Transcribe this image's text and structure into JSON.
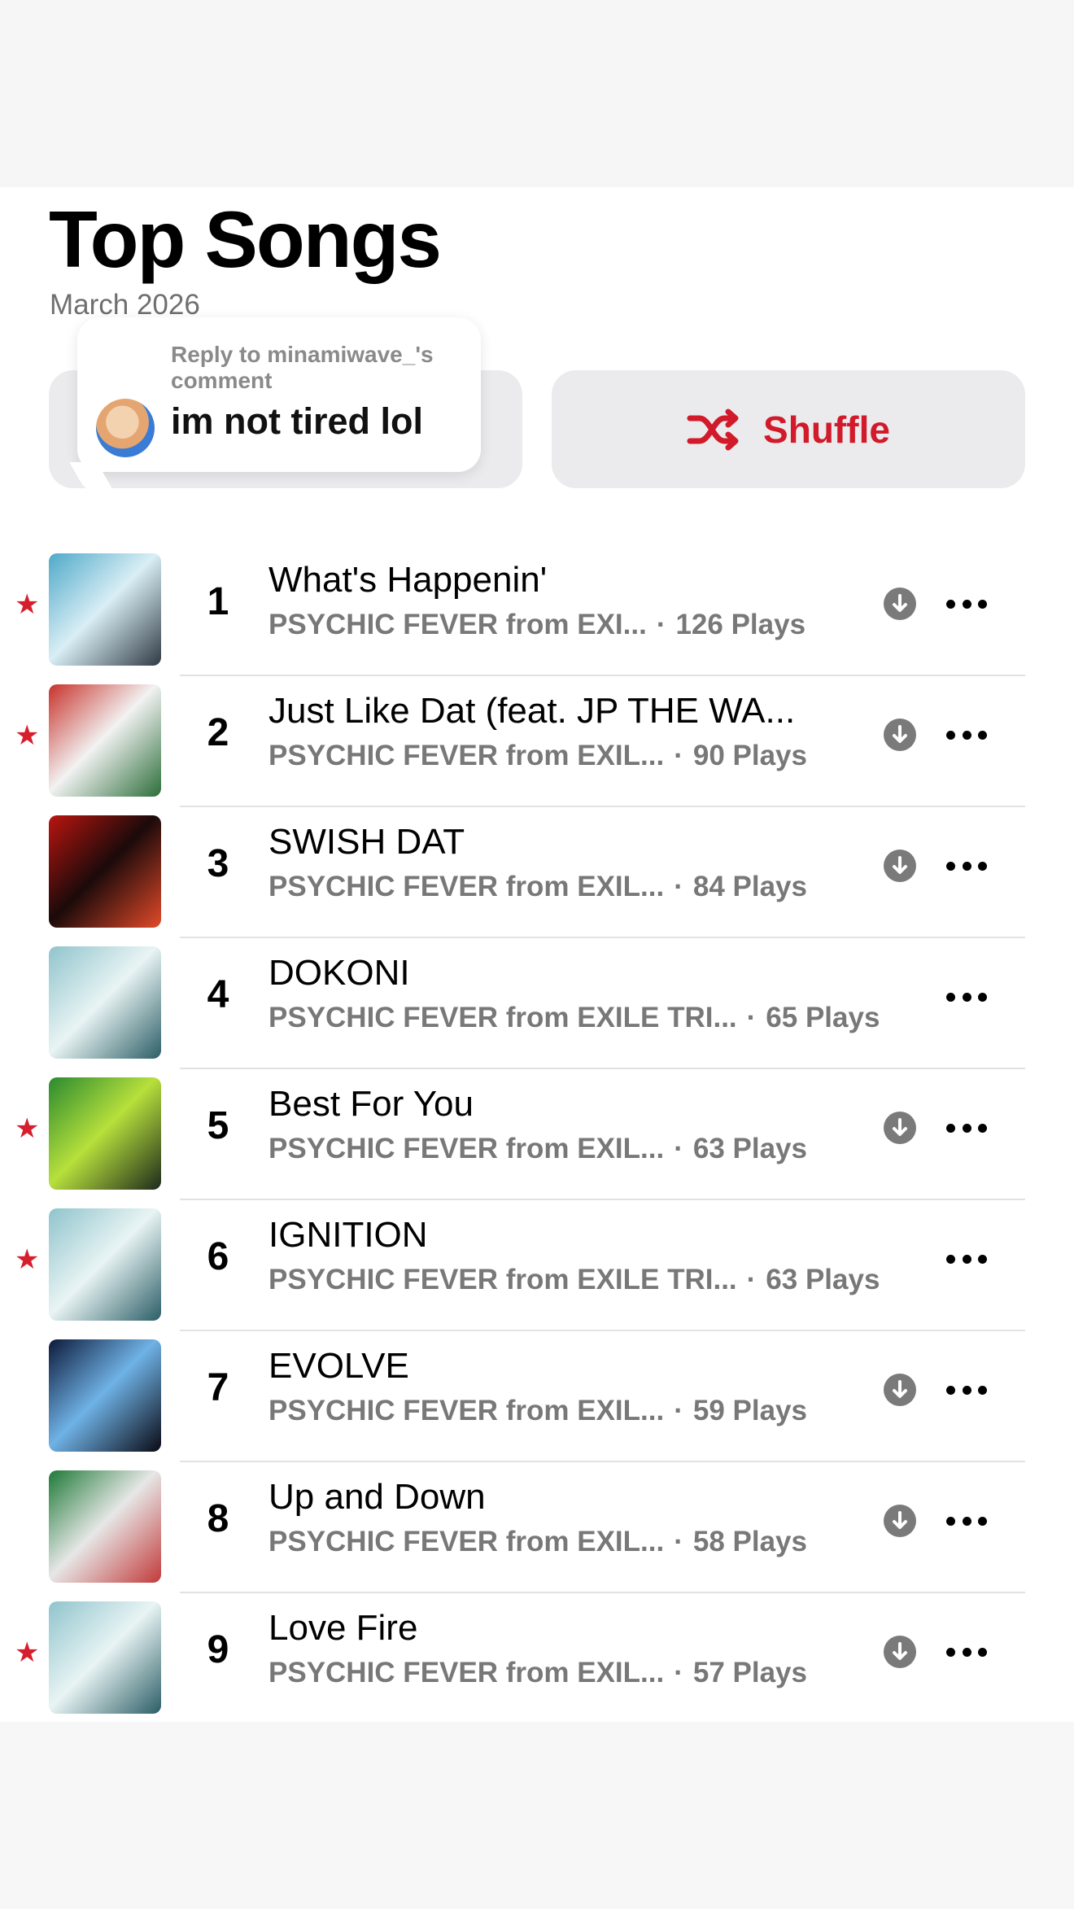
{
  "header": {
    "title": "Top Songs",
    "subtitle": "March 2026"
  },
  "reply_bubble": {
    "meta": "Reply to minamiwave_'s comment",
    "text": "im not tired lol"
  },
  "buttons": {
    "shuffle_label": "Shuffle"
  },
  "colors": {
    "accent": "#d11a2a",
    "star": "#d61f2d",
    "secondary_text": "#787878"
  },
  "songs": [
    {
      "rank": "1",
      "title": "What's Happenin'",
      "artist": "PSYCHIC FEVER from EXI...",
      "plays": "126 Plays",
      "starred": true,
      "downloadable": true,
      "art": [
        "#4fa9c9",
        "#d9eef5",
        "#2f3a44"
      ]
    },
    {
      "rank": "2",
      "title": "Just Like Dat (feat. JP THE WA...",
      "artist": "PSYCHIC FEVER from EXIL...",
      "plays": "90 Plays",
      "starred": true,
      "downloadable": true,
      "art": [
        "#c8322b",
        "#f2f2f2",
        "#2c6e3a"
      ]
    },
    {
      "rank": "3",
      "title": "SWISH DAT",
      "artist": "PSYCHIC FEVER from EXIL...",
      "plays": "84 Plays",
      "starred": false,
      "downloadable": true,
      "art": [
        "#b9150f",
        "#1b0a0a",
        "#e24a2a"
      ]
    },
    {
      "rank": "4",
      "title": "DOKONI",
      "artist": "PSYCHIC FEVER from EXILE TRI...",
      "plays": "65 Plays",
      "starred": false,
      "downloadable": false,
      "art": [
        "#8fc4cc",
        "#e9f4f4",
        "#2b5e66"
      ]
    },
    {
      "rank": "5",
      "title": "Best For You",
      "artist": "PSYCHIC FEVER from EXIL...",
      "plays": "63 Plays",
      "starred": true,
      "downloadable": true,
      "art": [
        "#2a8a2f",
        "#b7e03c",
        "#1d2a1b"
      ]
    },
    {
      "rank": "6",
      "title": "IGNITION",
      "artist": "PSYCHIC FEVER from EXILE TRI...",
      "plays": "63 Plays",
      "starred": true,
      "downloadable": false,
      "art": [
        "#8fc4cc",
        "#e9f4f4",
        "#2b5e66"
      ]
    },
    {
      "rank": "7",
      "title": "EVOLVE",
      "artist": "PSYCHIC FEVER from EXIL...",
      "plays": "59 Plays",
      "starred": false,
      "downloadable": true,
      "art": [
        "#0d1a3a",
        "#6fb2e6",
        "#0a0a14"
      ]
    },
    {
      "rank": "8",
      "title": "Up and Down",
      "artist": "PSYCHIC FEVER from EXIL...",
      "plays": "58 Plays",
      "starred": false,
      "downloadable": true,
      "art": [
        "#1e7a38",
        "#e7e7e7",
        "#c23a3a"
      ]
    },
    {
      "rank": "9",
      "title": "Love Fire",
      "artist": "PSYCHIC FEVER from EXIL...",
      "plays": "57 Plays",
      "starred": true,
      "downloadable": true,
      "art": [
        "#8fc4cc",
        "#e9f4f4",
        "#2b5e66"
      ]
    }
  ]
}
